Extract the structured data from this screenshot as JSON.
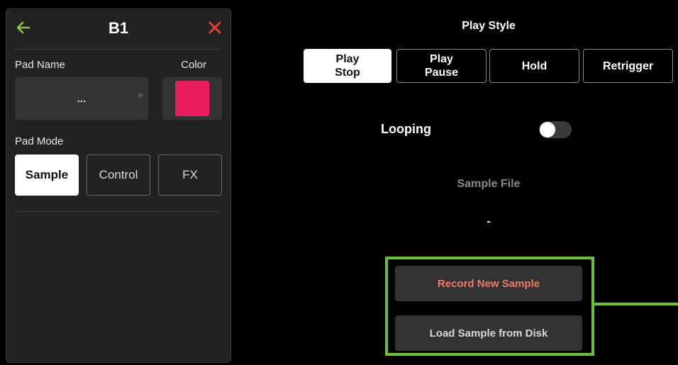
{
  "panel": {
    "title": "B1",
    "pad_name_label": "Pad Name",
    "pad_name_value": "...",
    "color_label": "Color",
    "pad_mode_label": "Pad Mode",
    "modes": [
      {
        "label": "Sample",
        "active": true
      },
      {
        "label": "Control",
        "active": false
      },
      {
        "label": "FX",
        "active": false
      }
    ],
    "pad_color": "#ec1d5e"
  },
  "play_style": {
    "title": "Play Style",
    "options": [
      {
        "label": "Play\nStop",
        "active": true
      },
      {
        "label": "Play\nPause",
        "active": false
      },
      {
        "label": "Hold",
        "active": false
      },
      {
        "label": "Retrigger",
        "active": false
      }
    ]
  },
  "looping": {
    "label": "Looping",
    "enabled": false
  },
  "sample_file": {
    "label": "Sample File",
    "value": "-"
  },
  "actions": {
    "record_label": "Record New Sample",
    "load_label": "Load Sample from Disk"
  },
  "colors": {
    "back_icon": "#8cc63f",
    "close_icon": "#e8413c",
    "record_text": "#f07a6a",
    "load_text": "#d8d8d8",
    "highlight": "#6abf3a"
  },
  "icons": {
    "back": "arrow-left-icon",
    "close": "close-icon",
    "name_arrow": "triangle-right-icon"
  }
}
